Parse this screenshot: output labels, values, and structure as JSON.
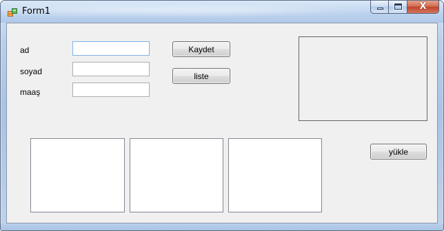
{
  "window": {
    "title": "Form1",
    "colors": {
      "client_background": "#f0f0f0",
      "titlebar_tint": "#bdd3ee",
      "close_button": "#c0452b",
      "focus_border": "#7eb4ea"
    },
    "icons": {
      "app": "form-app-icon",
      "minimize": "minimize-icon",
      "maximize": "maximize-icon",
      "close": "close-icon"
    },
    "close_glyph": "X"
  },
  "form": {
    "fields": [
      {
        "label": "ad",
        "value": "",
        "placeholder": ""
      },
      {
        "label": "soyad",
        "value": "",
        "placeholder": ""
      },
      {
        "label": "maaş",
        "value": "",
        "placeholder": ""
      }
    ],
    "buttons": {
      "save": "Kaydet",
      "list": "liste",
      "load": "yükle"
    }
  }
}
